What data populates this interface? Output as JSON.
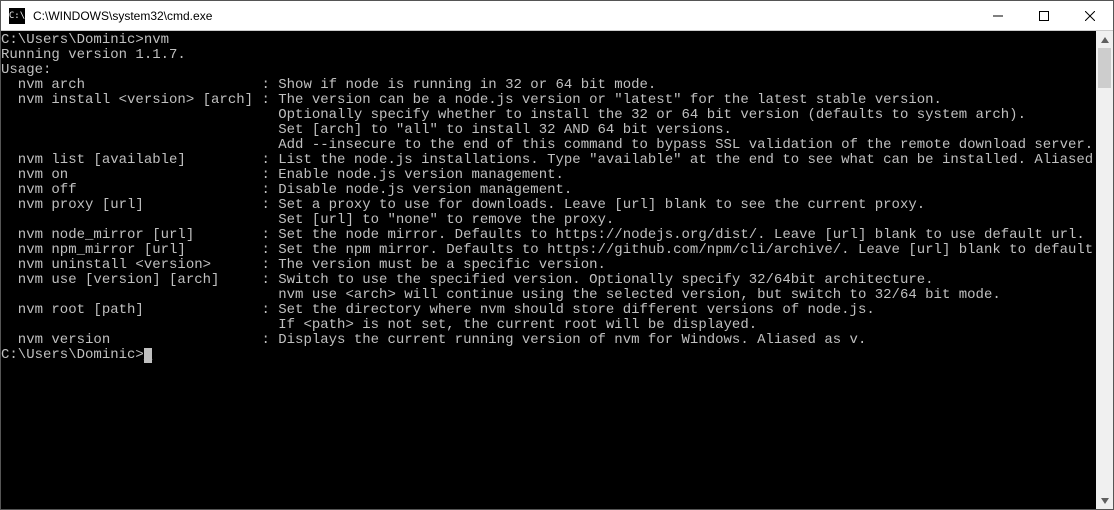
{
  "window": {
    "title": "C:\\WINDOWS\\system32\\cmd.exe",
    "icon_name": "cmd-icon",
    "icon_glyph": "C:\\"
  },
  "session": {
    "prompt1_prefix": "C:\\Users\\Dominic>",
    "prompt1_cmd": "nvm",
    "blank": "",
    "running": "Running version 1.1.7.",
    "usage": "Usage:",
    "lines": [
      "  nvm arch                     : Show if node is running in 32 or 64 bit mode.",
      "  nvm install <version> [arch] : The version can be a node.js version or \"latest\" for the latest stable version.",
      "                                 Optionally specify whether to install the 32 or 64 bit version (defaults to system arch).",
      "                                 Set [arch] to \"all\" to install 32 AND 64 bit versions.",
      "                                 Add --insecure to the end of this command to bypass SSL validation of the remote download server.",
      "  nvm list [available]         : List the node.js installations. Type \"available\" at the end to see what can be installed. Aliased as ls.",
      "",
      "  nvm on                       : Enable node.js version management.",
      "  nvm off                      : Disable node.js version management.",
      "  nvm proxy [url]              : Set a proxy to use for downloads. Leave [url] blank to see the current proxy.",
      "                                 Set [url] to \"none\" to remove the proxy.",
      "  nvm node_mirror [url]        : Set the node mirror. Defaults to https://nodejs.org/dist/. Leave [url] blank to use default url.",
      "  nvm npm_mirror [url]         : Set the npm mirror. Defaults to https://github.com/npm/cli/archive/. Leave [url] blank to default url.",
      "  nvm uninstall <version>      : The version must be a specific version.",
      "  nvm use [version] [arch]     : Switch to use the specified version. Optionally specify 32/64bit architecture.",
      "                                 nvm use <arch> will continue using the selected version, but switch to 32/64 bit mode.",
      "  nvm root [path]              : Set the directory where nvm should store different versions of node.js.",
      "                                 If <path> is not set, the current root will be displayed.",
      "  nvm version                  : Displays the current running version of nvm for Windows. Aliased as v."
    ],
    "prompt2_prefix": "C:\\Users\\Dominic>",
    "cursor": "_"
  }
}
